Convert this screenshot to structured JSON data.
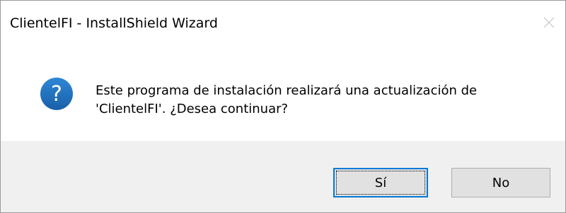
{
  "window": {
    "title": "ClientelFI - InstallShield Wizard"
  },
  "message": {
    "line1": "Este programa de instalación realizará una actualización de",
    "line2": "'ClientelFI'.  ¿Desea continuar?"
  },
  "buttons": {
    "yes_label": "Sí",
    "no_label": "No"
  },
  "icons": {
    "dialog_icon": "question-icon",
    "close": "close-icon"
  },
  "colors": {
    "question_icon_fill": "#1e73be",
    "focus_border": "#0078d7",
    "footer_background": "#f0f0f0"
  }
}
